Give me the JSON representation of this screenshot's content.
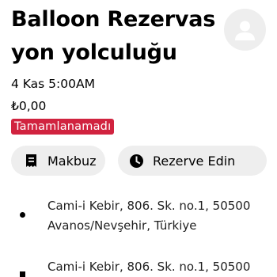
{
  "trip": {
    "title": "Balloon Rezervas yon yolculuğu",
    "datetime": "4 Kas 5:00AM",
    "price": "₺0,00",
    "status": "Tamamlanamadı",
    "status_color": "#d1233f"
  },
  "actions": {
    "receipt_label": "Makbuz",
    "reserve_label": "Rezerve Edin"
  },
  "route": {
    "pickup_line1": "Cami-i Kebir, 806. Sk. no.1, 50500",
    "pickup_line2": "Avanos/Nevşehir, Türkiye",
    "dropoff_line1": "Cami-i Kebir, 806. Sk. no.1, 50500"
  },
  "icons": {
    "avatar": "person-icon",
    "receipt": "receipt-icon",
    "reserve": "clock-icon"
  }
}
